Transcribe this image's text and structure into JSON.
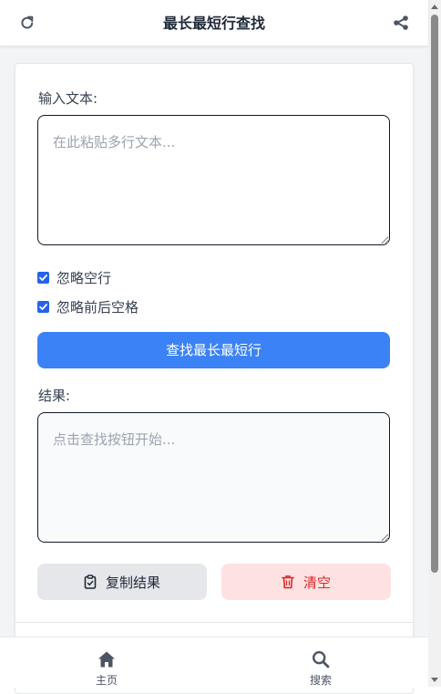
{
  "header": {
    "title": "最长最短行查找",
    "left_icon": "refresh-icon",
    "right_icon": "share-icon"
  },
  "form": {
    "input_label": "输入文本:",
    "input_value": "",
    "input_placeholder": "在此粘贴多行文本...",
    "options": [
      {
        "label": "忽略空行",
        "checked": true
      },
      {
        "label": "忽略前后空格",
        "checked": true
      }
    ],
    "find_button": "查找最长最短行",
    "result_label": "结果:",
    "result_value": "",
    "result_placeholder": "点击查找按钮开始...",
    "copy_button": "复制结果",
    "copy_icon": "clipboard-icon",
    "clear_button": "清空",
    "clear_icon": "trash-icon"
  },
  "bottom_nav": {
    "items": [
      {
        "label": "主页",
        "icon": "home-icon"
      },
      {
        "label": "搜索",
        "icon": "search-icon"
      }
    ]
  },
  "colors": {
    "primary": "#3b82f6",
    "danger": "#dc2626",
    "danger_bg": "#fee2e2",
    "checkbox": "#2563eb"
  }
}
